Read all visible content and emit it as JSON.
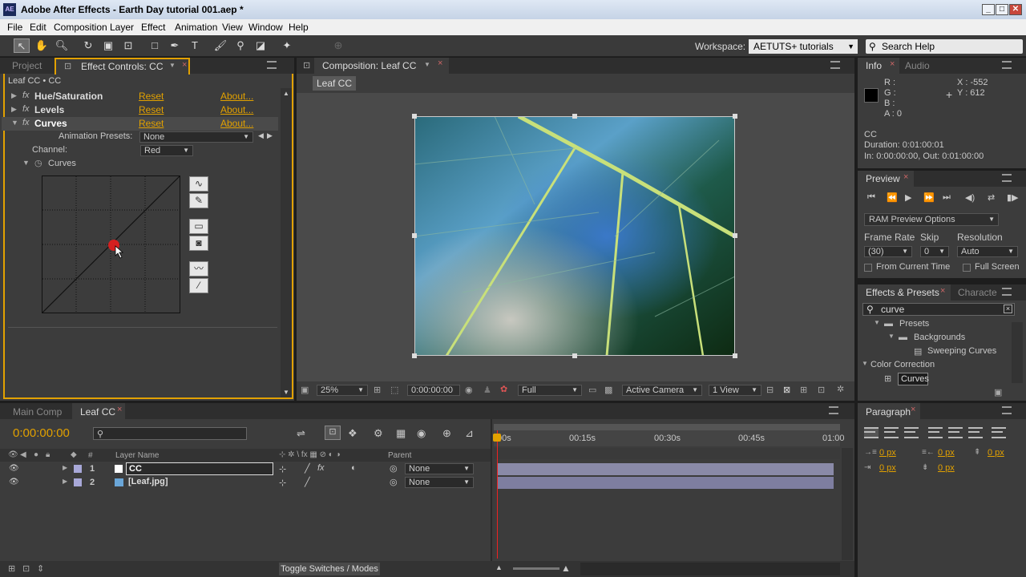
{
  "window": {
    "title": "Adobe After Effects - Earth Day tutorial 001.aep *",
    "app_icon": "AE"
  },
  "menu": [
    "File",
    "Edit",
    "Composition",
    "Layer",
    "Effect",
    "Animation",
    "View",
    "Window",
    "Help"
  ],
  "workspace": {
    "label": "Workspace:",
    "value": "AETUTS+ tutorials"
  },
  "search_help": {
    "placeholder": "Search Help"
  },
  "left_panel": {
    "tabs": [
      "Project",
      "Effect Controls: CC"
    ],
    "breadcrumb": "Leaf CC • CC",
    "effects": [
      {
        "name": "Hue/Saturation",
        "reset": "Reset",
        "about": "About..."
      },
      {
        "name": "Levels",
        "reset": "Reset",
        "about": "About..."
      },
      {
        "name": "Curves",
        "reset": "Reset",
        "about": "About..."
      }
    ],
    "animation_presets": {
      "label": "Animation Presets:",
      "value": "None"
    },
    "channel": {
      "label": "Channel:",
      "value": "Red"
    },
    "curves_label": "Curves"
  },
  "composition": {
    "tab": "Composition: Leaf CC",
    "sub_tab": "Leaf CC",
    "zoom": "25%",
    "timecode": "0:00:00:00",
    "resolution": "Full",
    "camera": "Active Camera",
    "views": "1 View"
  },
  "info": {
    "tabs": [
      "Info",
      "Audio"
    ],
    "r": "R :",
    "g": "G :",
    "b": "B :",
    "a": "A : 0",
    "x": "X : -552",
    "y": "Y : 612",
    "layer": "CC",
    "duration": "Duration: 0:01:00:01",
    "in_out": "In: 0:00:00:00, Out: 0:01:00:00"
  },
  "preview": {
    "tab": "Preview",
    "ram_options": "RAM Preview Options",
    "frame_rate_label": "Frame Rate",
    "frame_rate": "(30)",
    "skip_label": "Skip",
    "skip": "0",
    "resolution_label": "Resolution",
    "resolution": "Auto",
    "from_current": "From Current Time",
    "full_screen": "Full Screen"
  },
  "effects_presets": {
    "tabs": [
      "Effects & Presets",
      "Characte"
    ],
    "search": "curve",
    "tree": [
      {
        "label": "Presets",
        "level": 0
      },
      {
        "label": "Backgrounds",
        "level": 1
      },
      {
        "label": "Sweeping Curves",
        "level": 2
      },
      {
        "label": "Color Correction",
        "level": 0
      },
      {
        "label": "Curves",
        "level": 1
      }
    ]
  },
  "paragraph": {
    "tab": "Paragraph",
    "fields": [
      "0 px",
      "0 px",
      "0 px",
      "0 px",
      "0 px"
    ]
  },
  "timeline": {
    "tabs": [
      "Main Comp",
      "Leaf CC"
    ],
    "timecode": "0:00:00:00",
    "col_layer": "Layer Name",
    "col_num": "#",
    "col_parent": "Parent",
    "ruler": [
      "00s",
      "00:15s",
      "00:30s",
      "00:45s",
      "01:00"
    ],
    "layers": [
      {
        "num": "1",
        "name": "CC",
        "parent": "None"
      },
      {
        "num": "2",
        "name": "[Leaf.jpg]",
        "parent": "None"
      }
    ],
    "toggle": "Toggle Switches / Modes"
  },
  "colors": {
    "accent": "#e2a100",
    "panel": "#3c3c3c",
    "track": "#8a8aa8"
  }
}
